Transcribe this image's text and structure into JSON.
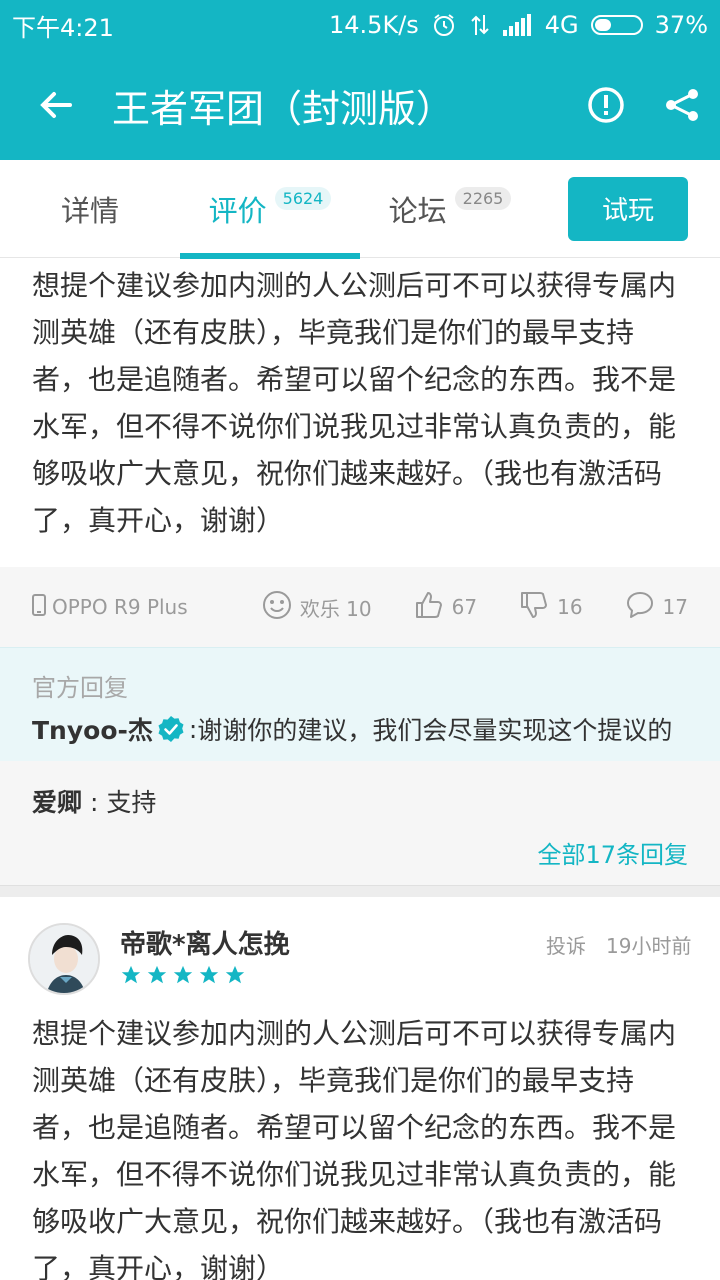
{
  "status_bar": {
    "time": "下午4:21",
    "network_speed": "14.5K/s",
    "network_type": "4G",
    "battery_percent": "37%",
    "battery_level": 0.37
  },
  "app_bar": {
    "title": "王者军团（封测版）",
    "icons": [
      "back-arrow-icon",
      "alert-icon",
      "share-icon"
    ]
  },
  "tabs": [
    {
      "label": "详情",
      "count": ""
    },
    {
      "label": "评价",
      "count": "5624"
    },
    {
      "label": "论坛",
      "count": "2265"
    }
  ],
  "try_button": "试玩",
  "review1": {
    "lines": [
      "想提个建议参加内测的人公测后可不可以获得专属内",
      "测英雄（还有皮肤），毕竟我们是你们的最早支持",
      "者，也是追随者。希望可以留个纪念的东西。我不是",
      "水军，但不得不说你们说我见过非常认真负责的，能",
      "够吸收广大意见，祝你们越来越好。（我也有激活码",
      "了，真开心，谢谢）"
    ],
    "device": "OPPO R9 Plus",
    "fun_label": "欢乐 10",
    "likes": "67",
    "dislikes": "16",
    "comments": "17"
  },
  "official_reply": {
    "label": "官方回复",
    "name": "Tnyoo-杰",
    "separator": " : ",
    "text": "谢谢你的建议，我们会尽量实现这个提议的"
  },
  "reply": {
    "name": "爱卿",
    "separator": " : ",
    "text": "支持",
    "all_replies": "全部17条回复"
  },
  "review2": {
    "user_name": "帝歌*离人怎挽",
    "rating": 5,
    "report": "投诉",
    "time": "19小时前",
    "lines": [
      "想提个建议参加内测的人公测后可不可以获得专属内",
      "测英雄（还有皮肤），毕竟我们是你们的最早支持",
      "者，也是追随者。希望可以留个纪念的东西。我不是",
      "水军，但不得不说你们说我见过非常认真负责的，能",
      "够吸收广大意见，祝你们越来越好。（我也有激活码",
      "了，真开心，谢谢）"
    ]
  },
  "colors": {
    "accent": "#14b6c4",
    "official_bg": "#eaf7f9",
    "muted_bg": "#f6f6f6"
  }
}
